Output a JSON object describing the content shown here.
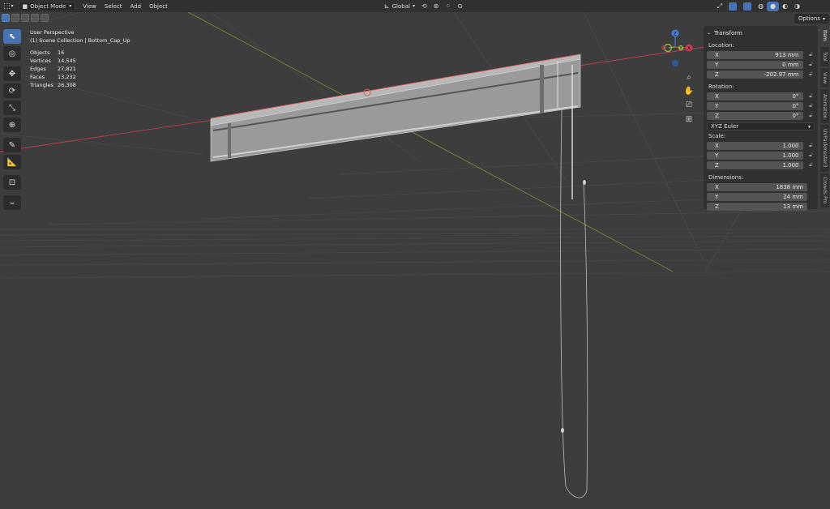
{
  "header": {
    "mode_label": "Object Mode",
    "menus": [
      "View",
      "Select",
      "Add",
      "Object"
    ],
    "orientation_label": "Global"
  },
  "options_label": "Options",
  "overlay": {
    "view_name": "User Perspective",
    "collection_line": "(1) Scene Collection | Bottom_Cap_Up",
    "stats": [
      {
        "label": "Objects",
        "value": "16"
      },
      {
        "label": "Vertices",
        "value": "14,545"
      },
      {
        "label": "Edges",
        "value": "27,821"
      },
      {
        "label": "Faces",
        "value": "13,232"
      },
      {
        "label": "Triangles",
        "value": "26,308"
      }
    ]
  },
  "gizmo": {
    "z": "Z",
    "y": "Y",
    "x": "X"
  },
  "transform": {
    "title": "Transform",
    "location_label": "Location:",
    "location": [
      {
        "axis": "X",
        "value": "913 mm"
      },
      {
        "axis": "Y",
        "value": "0 mm"
      },
      {
        "axis": "Z",
        "value": "-202.97 mm"
      }
    ],
    "rotation_label": "Rotation:",
    "rotation": [
      {
        "axis": "X",
        "value": "0°"
      },
      {
        "axis": "Y",
        "value": "0°"
      },
      {
        "axis": "Z",
        "value": "0°"
      }
    ],
    "rotation_mode": "XYZ Euler",
    "scale_label": "Scale:",
    "scale": [
      {
        "axis": "X",
        "value": "1.000"
      },
      {
        "axis": "Y",
        "value": "1.000"
      },
      {
        "axis": "Z",
        "value": "1.000"
      }
    ],
    "dimensions_label": "Dimensions:",
    "dimensions": [
      {
        "axis": "X",
        "value": "1838 mm"
      },
      {
        "axis": "Y",
        "value": "24 mm"
      },
      {
        "axis": "Z",
        "value": "13 mm"
      }
    ]
  },
  "tabs": [
    "Item",
    "Tool",
    "View",
    "Animation",
    "UVPackmaster3",
    "Crowds Pro"
  ],
  "colors": {
    "accent": "#4772b3",
    "x_axis": "#c84050",
    "y_axis": "#8fb04a",
    "z_axis": "#4a7fd0"
  }
}
